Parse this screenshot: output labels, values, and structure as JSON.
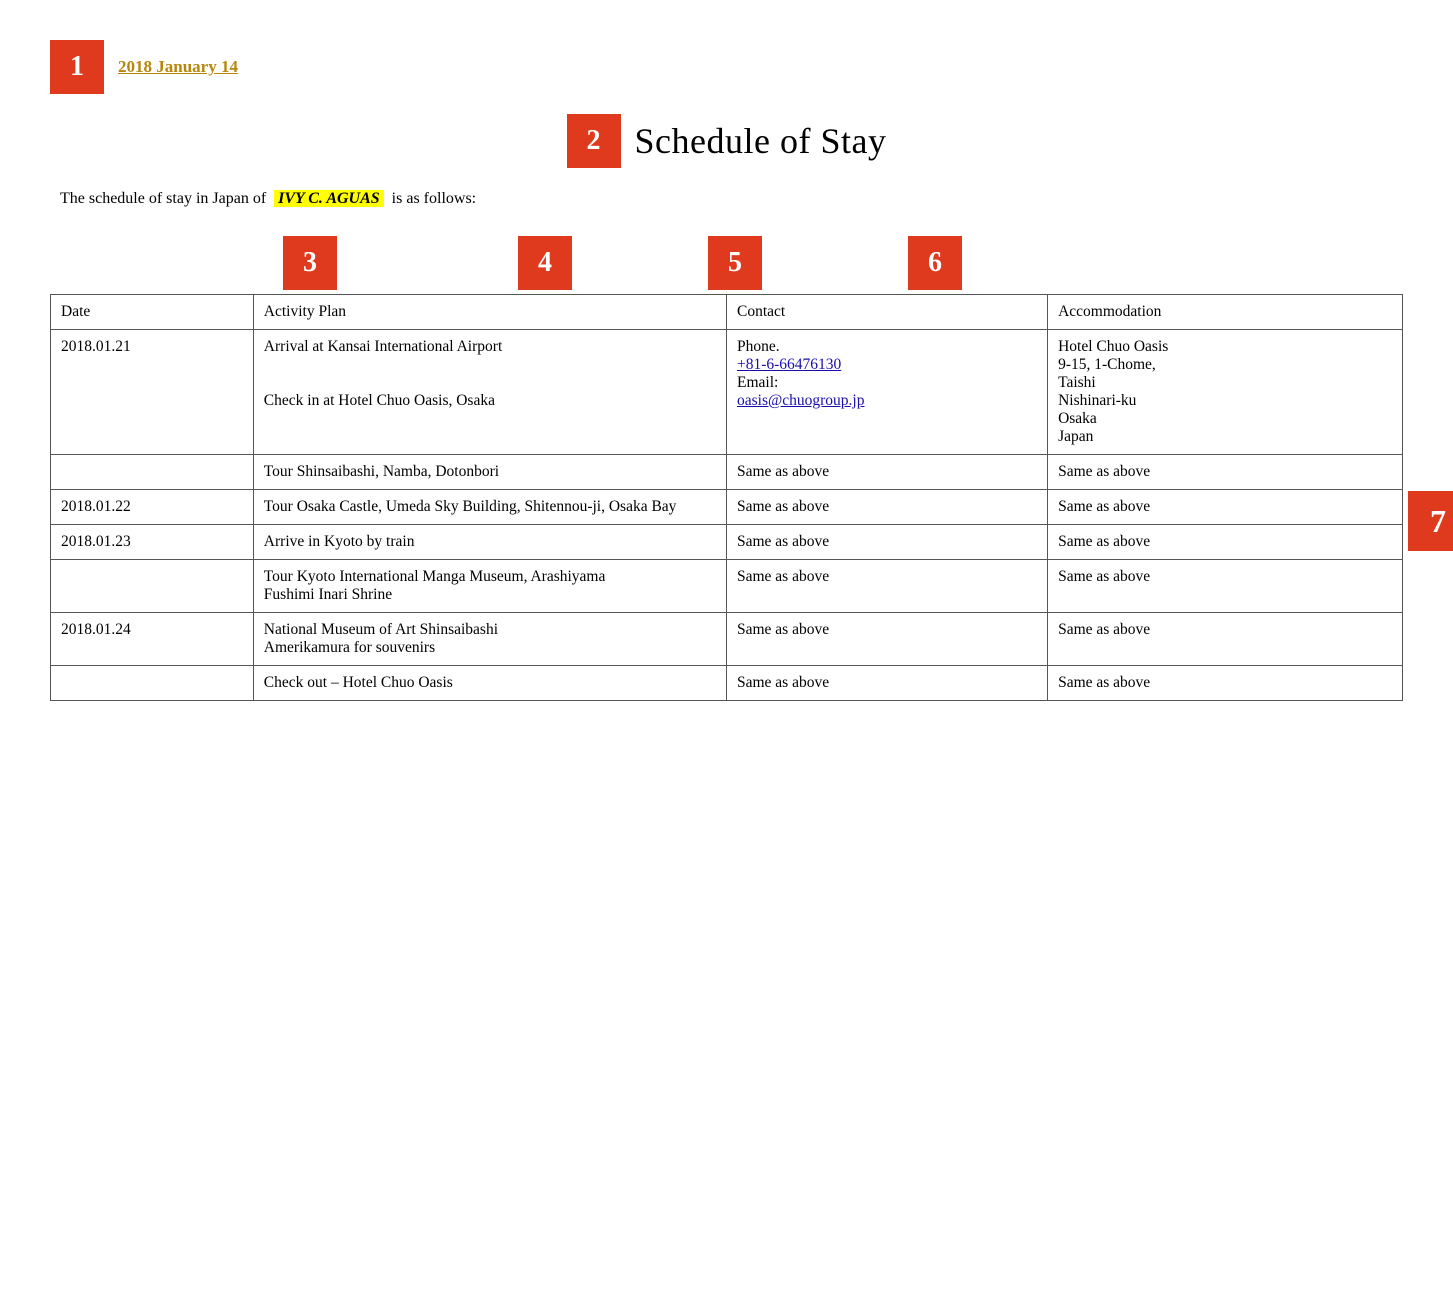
{
  "header": {
    "badge": "1",
    "date": "2018 January 14"
  },
  "title": {
    "badge": "2",
    "text": "Schedule of Stay"
  },
  "subtitle": {
    "before": "The schedule of stay in Japan of",
    "name": "IVY C. AGUAS",
    "after": "is as follows:"
  },
  "columns": [
    {
      "badge": "3",
      "label": "Date"
    },
    {
      "badge": "4",
      "label": "Activity Plan"
    },
    {
      "badge": "5",
      "label": "Contact"
    },
    {
      "badge": "6",
      "label": "Accommodation"
    }
  ],
  "badge7": "7",
  "rows": [
    {
      "date": "2018.01.21",
      "activity": "Arrival at Kansai International Airport\n\nCheck in at Hotel Chuo Oasis, Osaka",
      "contact_type": "full",
      "contact_phone_label": "Phone.",
      "contact_phone": "+81-6-66476130",
      "contact_email_label": "Email:",
      "contact_email": "oasis@chuogroup.jp",
      "accommodation_type": "full",
      "accommodation": "Hotel Chuo Oasis\n9-15, 1-Chome,\nTaishi\nNishinari-ku\nOsaka\nJapan"
    },
    {
      "date": "",
      "activity": "Tour Shinsaibashi, Namba, Dotonbori",
      "contact_type": "same",
      "contact": "Same as above",
      "accommodation_type": "same",
      "accommodation": "Same as above"
    },
    {
      "date": "2018.01.22",
      "activity": "Tour Osaka Castle, Umeda Sky Building, Shitennou-ji, Osaka Bay",
      "contact_type": "same",
      "contact": "Same as above",
      "accommodation_type": "same",
      "accommodation": "Same as above"
    },
    {
      "date": "2018.01.23",
      "activity": "Arrive in Kyoto by train",
      "contact_type": "same",
      "contact": "Same as above",
      "accommodation_type": "same",
      "accommodation": "Same as above"
    },
    {
      "date": "",
      "activity": "Tour Kyoto International Manga Museum, Arashiyama\nFushimi Inari Shrine",
      "contact_type": "same",
      "contact": "Same as above",
      "accommodation_type": "same",
      "accommodation": "Same as above"
    },
    {
      "date": "2018.01.24",
      "activity": "National Museum of Art Shinsaibashi\nAmerikamura for souvenirs",
      "contact_type": "same",
      "contact": "Same as above",
      "accommodation_type": "same",
      "accommodation": "Same as above"
    },
    {
      "date": "",
      "activity": "Check out – Hotel Chuo Oasis",
      "contact_type": "same",
      "contact": "Same as above",
      "accommodation_type": "same",
      "accommodation": "Same as above"
    }
  ]
}
